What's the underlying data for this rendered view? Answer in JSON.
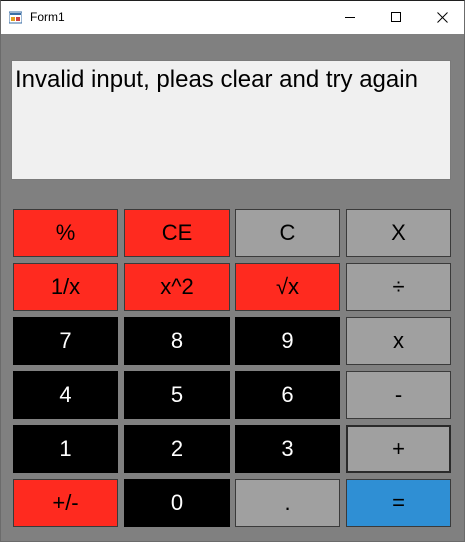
{
  "window": {
    "title": "Form1"
  },
  "display": {
    "text": "Invalid input, pleas clear and try again"
  },
  "colors": {
    "operator_red": "#ff2a1f",
    "control_gray": "#a0a0a0",
    "digit_black": "#000000",
    "equals_blue": "#2f8fd4",
    "form_bg": "#808080"
  },
  "buttons": {
    "percent": "%",
    "ce": "CE",
    "c": "C",
    "backspace": "X",
    "reciprocal": "1/x",
    "square": "x^2",
    "sqrt": "√x",
    "divide": "÷",
    "seven": "7",
    "eight": "8",
    "nine": "9",
    "multiply": "x",
    "four": "4",
    "five": "5",
    "six": "6",
    "minus": "-",
    "one": "1",
    "two": "2",
    "three": "3",
    "plus": "+",
    "negate": "+/-",
    "zero": "0",
    "decimal": ".",
    "equals": "="
  }
}
